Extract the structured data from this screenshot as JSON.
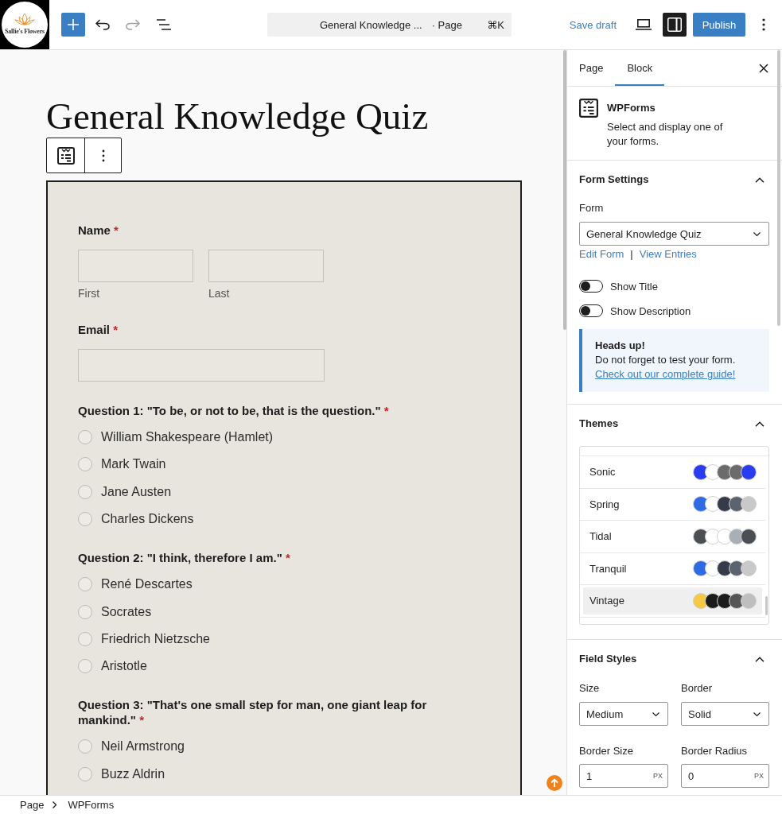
{
  "logo": {
    "text": "Sallie's Flowers"
  },
  "top_bar": {
    "history": [
      {
        "kind": "undo",
        "disabled": false
      },
      {
        "kind": "redo",
        "disabled": true
      }
    ],
    "command_bar": {
      "title": "General Knowledge ...",
      "type": "· Page",
      "shortcut": "⌘K"
    },
    "save_draft": "Save draft",
    "settings_toggle": {
      "pressed": true
    },
    "publish": "Publish"
  },
  "page_title": "General Knowledge Quiz",
  "form": {
    "fields": [
      {
        "kind": "name",
        "label": "Name",
        "required_mark": "*",
        "inputs": [
          {
            "sublabel": "First"
          },
          {
            "sublabel": "Last"
          }
        ]
      },
      {
        "kind": "email",
        "label": "Email",
        "required_mark": "*"
      },
      {
        "kind": "choice",
        "label": "Question 1: \"To be, or not to be, that is the question.\"",
        "required_mark": "*",
        "options": [
          {
            "label": "William Shakespeare (Hamlet)",
            "selected": false
          },
          {
            "label": "Mark Twain",
            "selected": false
          },
          {
            "label": "Jane Austen",
            "selected": false
          },
          {
            "label": "Charles Dickens",
            "selected": false
          }
        ]
      },
      {
        "kind": "choice",
        "label": "Question 2: \"I think, therefore I am.\"",
        "required_mark": "*",
        "options": [
          {
            "label": "René Descartes",
            "selected": false
          },
          {
            "label": "Socrates",
            "selected": false
          },
          {
            "label": "Friedrich Nietzsche",
            "selected": false
          },
          {
            "label": "Aristotle",
            "selected": false
          }
        ]
      },
      {
        "kind": "choice",
        "label": "Question 3: \"That's one small step for man, one giant leap for mankind.\"",
        "required_mark": "*",
        "options": [
          {
            "label": "Neil Armstrong",
            "selected": false
          },
          {
            "label": "Buzz Aldrin",
            "selected": false
          }
        ]
      }
    ]
  },
  "sidebar": {
    "tabs": [
      {
        "label": "Page",
        "selected": false
      },
      {
        "label": "Block",
        "selected": true
      }
    ],
    "block": {
      "name": "WPForms",
      "description": "Select and display one of your forms."
    },
    "form_settings": {
      "title": "Form Settings",
      "expanded": true,
      "form_label": "Form",
      "form_value": "General Knowledge Quiz",
      "links": [
        "Edit Form",
        "View Entries"
      ],
      "separator": "|",
      "toggles": [
        {
          "label": "Show Title",
          "on": false
        },
        {
          "label": "Show Description",
          "on": false
        }
      ],
      "notice": {
        "title": "Heads up!",
        "text": "Do not forget to test your form.",
        "link": "Check out our complete guide!"
      }
    },
    "themes": {
      "title": "Themes",
      "expanded": true,
      "items": [
        {
          "name": "Sonic",
          "selected": false,
          "swatches": [
            {
              "color": "#2a3cf0"
            },
            {
              "color": "#ffffff"
            },
            {
              "color": "#6b6b6b"
            },
            {
              "color": "#6b6b6b"
            },
            {
              "color": "#2a3cf0"
            }
          ]
        },
        {
          "name": "Spring",
          "selected": false,
          "swatches": [
            {
              "color": "#2d6ae3"
            },
            {
              "color": "#ffffff"
            },
            {
              "color": "#353b48"
            },
            {
              "color": "#5c6370"
            },
            {
              "color": "#c9c9c9"
            }
          ]
        },
        {
          "name": "Tidal",
          "selected": false,
          "swatches": [
            {
              "color": "#4b4e53"
            },
            {
              "color": "#ffffff"
            },
            {
              "color": "#ffffff"
            },
            {
              "color": "#a9afb6"
            },
            {
              "color": "#4b4e53"
            }
          ]
        },
        {
          "name": "Tranquil",
          "selected": false,
          "swatches": [
            {
              "color": "#2d6ae3"
            },
            {
              "color": "#ffffff"
            },
            {
              "color": "#353b48"
            },
            {
              "color": "#5c6370"
            },
            {
              "color": "#c9c9c9"
            }
          ]
        },
        {
          "name": "Vintage",
          "selected": true,
          "swatches": [
            {
              "color": "#f6c844"
            },
            {
              "color": "#1b1b1b"
            },
            {
              "color": "#1b1b1b"
            },
            {
              "color": "#565656"
            },
            {
              "color": "#bebebe"
            }
          ]
        }
      ]
    },
    "field_styles": {
      "title": "Field Styles",
      "expanded": true,
      "selects": [
        {
          "label": "Size",
          "value": "Medium"
        },
        {
          "label": "Border",
          "value": "Solid"
        }
      ],
      "inputs": [
        {
          "label": "Border Size",
          "value": "1",
          "unit": "PX"
        },
        {
          "label": "Border Radius",
          "value": "0",
          "unit": "PX"
        }
      ]
    }
  },
  "status_bar": {
    "breadcrumbs": [
      "Page",
      "WPForms"
    ]
  }
}
